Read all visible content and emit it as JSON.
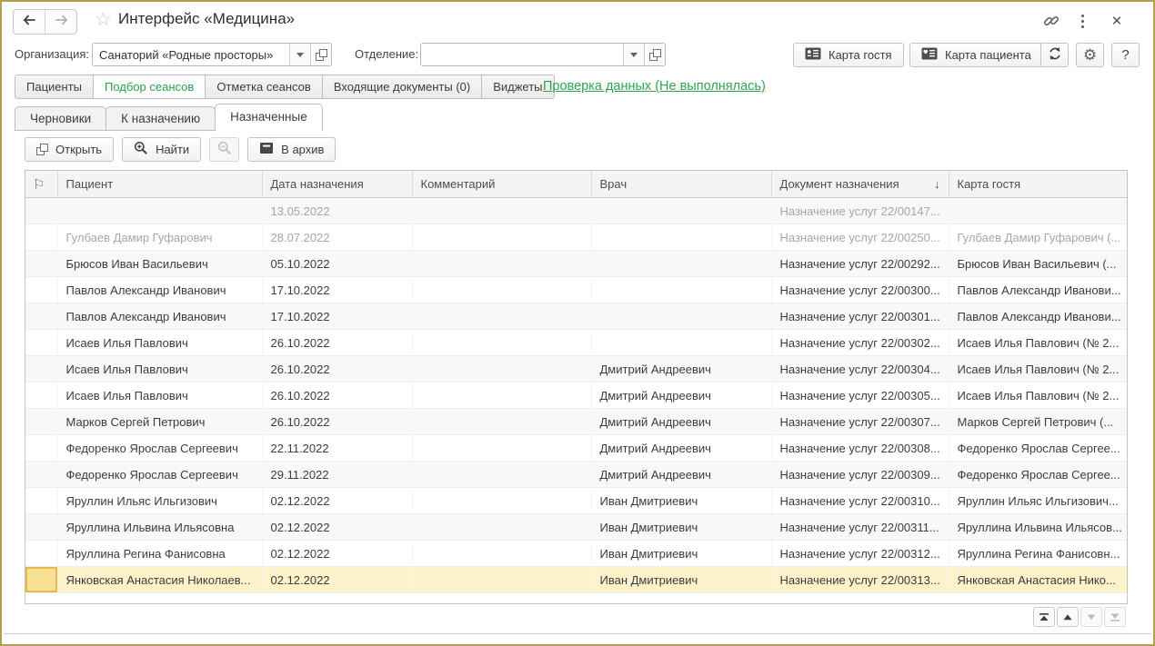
{
  "titlebar": {
    "title": "Интерфейс «Медицина»"
  },
  "icons": {
    "star": "☆",
    "close": "✕",
    "gear": "⚙",
    "help": "?",
    "flag": "⚐",
    "sort_down": "↓"
  },
  "filters": {
    "org_label": "Организация:",
    "org_value": "Санаторий «Родные просторы»",
    "dept_label": "Отделение:",
    "dept_value": "",
    "guest_card_btn": "Карта гостя",
    "patient_card_btn": "Карта пациента"
  },
  "main_tabs": {
    "items": [
      {
        "label": "Пациенты",
        "active": false
      },
      {
        "label": "Подбор сеансов",
        "active": true
      },
      {
        "label": "Отметка сеансов",
        "active": false
      },
      {
        "label": "Входящие документы (0)",
        "active": false
      },
      {
        "label": "Виджеты",
        "active": false
      }
    ],
    "check_link": "Проверка данных (Не выполнялась)"
  },
  "sub_tabs": {
    "items": [
      {
        "label": "Черновики",
        "active": false
      },
      {
        "label": "К назначению",
        "active": false
      },
      {
        "label": "Назначенные",
        "active": true
      }
    ]
  },
  "command_bar": {
    "open_label": "Открыть",
    "find_label": "Найти",
    "archive_label": "В архив"
  },
  "table": {
    "columns": [
      "Пациент",
      "Дата назначения",
      "Комментарий",
      "Врач",
      "Документ назначения",
      "Карта гостя"
    ],
    "sort_column": "Документ назначения",
    "rows": [
      {
        "patient": "",
        "date": "13.05.2022",
        "comment": "",
        "doctor": "",
        "doc": "Назначение услуг 22/00147...",
        "guest": "",
        "muted": true,
        "selected": false
      },
      {
        "patient": "Гулбаев Дамир Гуфарович",
        "date": "28.07.2022",
        "comment": "",
        "doctor": "",
        "doc": "Назначение услуг 22/00250...",
        "guest": "Гулбаев Дамир Гуфарович (...",
        "muted": true,
        "selected": false
      },
      {
        "patient": "Брюсов Иван Васильевич",
        "date": "05.10.2022",
        "comment": "",
        "doctor": "",
        "doc": "Назначение услуг 22/00292...",
        "guest": "Брюсов Иван Васильевич (...",
        "muted": false,
        "selected": false
      },
      {
        "patient": "Павлов Александр Иванович",
        "date": "17.10.2022",
        "comment": "",
        "doctor": "",
        "doc": "Назначение услуг 22/00300...",
        "guest": "Павлов Александр Иванови...",
        "muted": false,
        "selected": false
      },
      {
        "patient": "Павлов Александр Иванович",
        "date": "17.10.2022",
        "comment": "",
        "doctor": "",
        "doc": "Назначение услуг 22/00301...",
        "guest": "Павлов Александр Иванови...",
        "muted": false,
        "selected": false
      },
      {
        "patient": "Исаев Илья Павлович",
        "date": "26.10.2022",
        "comment": "",
        "doctor": "",
        "doc": "Назначение услуг 22/00302...",
        "guest": "Исаев Илья Павлович (№ 2...",
        "muted": false,
        "selected": false
      },
      {
        "patient": "Исаев Илья Павлович",
        "date": "26.10.2022",
        "comment": "",
        "doctor": "Дмитрий Андреевич",
        "doc": "Назначение услуг 22/00304...",
        "guest": "Исаев Илья Павлович (№ 2...",
        "muted": false,
        "selected": false
      },
      {
        "patient": "Исаев Илья Павлович",
        "date": "26.10.2022",
        "comment": "",
        "doctor": "Дмитрий Андреевич",
        "doc": "Назначение услуг 22/00305...",
        "guest": "Исаев Илья Павлович (№ 2...",
        "muted": false,
        "selected": false
      },
      {
        "patient": "Марков Сергей Петрович",
        "date": "26.10.2022",
        "comment": "",
        "doctor": "Дмитрий Андреевич",
        "doc": "Назначение услуг 22/00307...",
        "guest": "Марков Сергей Петрович (...",
        "muted": false,
        "selected": false
      },
      {
        "patient": "Федоренко Ярослав Сергеевич",
        "date": "22.11.2022",
        "comment": "",
        "doctor": "Дмитрий Андреевич",
        "doc": "Назначение услуг 22/00308...",
        "guest": "Федоренко Ярослав Сергее...",
        "muted": false,
        "selected": false
      },
      {
        "patient": "Федоренко Ярослав Сергеевич",
        "date": "29.11.2022",
        "comment": "",
        "doctor": "Дмитрий Андреевич",
        "doc": "Назначение услуг 22/00309...",
        "guest": "Федоренко Ярослав Сергее...",
        "muted": false,
        "selected": false
      },
      {
        "patient": "Яруллин Ильяс Ильгизович",
        "date": "02.12.2022",
        "comment": "",
        "doctor": "Иван Дмитриевич",
        "doc": "Назначение услуг 22/00310...",
        "guest": "Яруллин Ильяс Ильгизович...",
        "muted": false,
        "selected": false
      },
      {
        "patient": "Яруллина Ильвина Ильясовна",
        "date": "02.12.2022",
        "comment": "",
        "doctor": "Иван Дмитриевич",
        "doc": "Назначение услуг 22/00311...",
        "guest": "Яруллина Ильвина Ильясов...",
        "muted": false,
        "selected": false
      },
      {
        "patient": "Яруллина Регина Фанисовна",
        "date": "02.12.2022",
        "comment": "",
        "doctor": "Иван Дмитриевич",
        "doc": "Назначение услуг 22/00312...",
        "guest": "Яруллина Регина Фанисовн...",
        "muted": false,
        "selected": false
      },
      {
        "patient": "Янковская Анастасия Николаев...",
        "date": "02.12.2022",
        "comment": "",
        "doctor": "Иван Дмитриевич",
        "doc": "Назначение услуг 22/00313...",
        "guest": "Янковская Анастасия Нико...",
        "muted": false,
        "selected": true
      }
    ]
  },
  "colors": {
    "window_border": "#b2a04c",
    "accent_green": "#2da14c",
    "selected_row": "#fdf3cb",
    "current_cell": "#f9e193"
  }
}
